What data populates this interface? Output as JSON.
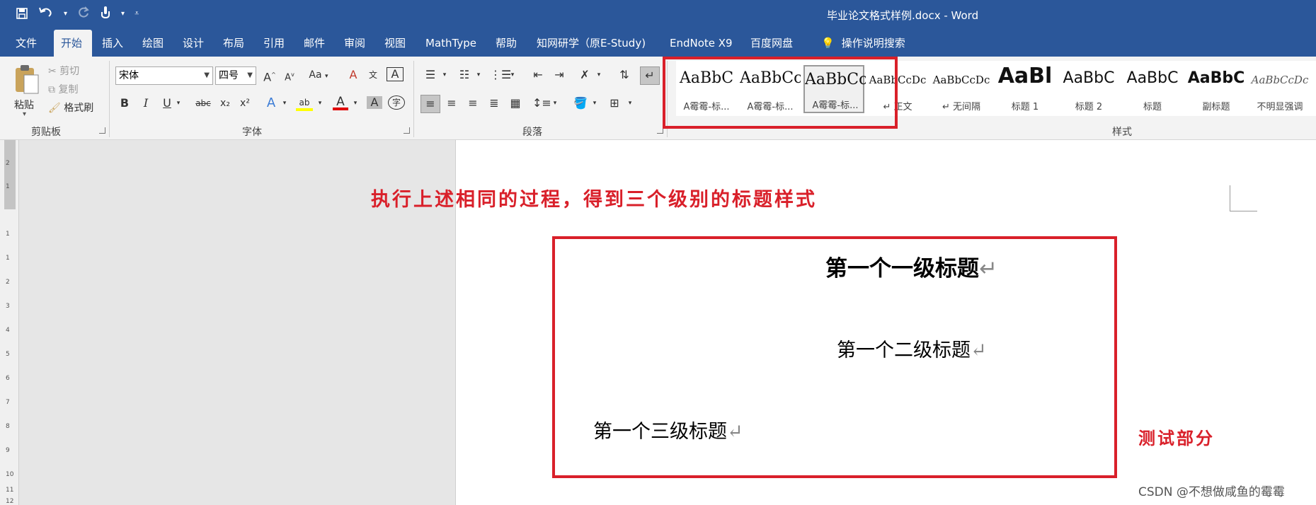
{
  "window": {
    "title": "毕业论文格式样例.docx  -  Word"
  },
  "qat": {
    "save_icon": "save-icon",
    "undo_icon": "undo-icon",
    "redo_icon": "redo-icon",
    "touch_icon": "touch-mode-icon",
    "customize_icon": "customize-icon"
  },
  "tabs": [
    "文件",
    "开始",
    "插入",
    "绘图",
    "设计",
    "布局",
    "引用",
    "邮件",
    "审阅",
    "视图",
    "MathType",
    "帮助",
    "知网研学（原E-Study)",
    "EndNote X9",
    "百度网盘"
  ],
  "tell_me": "操作说明搜索",
  "clipboard": {
    "paste": "粘贴",
    "cut": "剪切",
    "copy": "复制",
    "format_painter": "格式刷",
    "label": "剪贴板"
  },
  "font": {
    "name": "宋体",
    "size": "四号",
    "label": "字体",
    "bold": "B",
    "italic": "I",
    "underline": "U",
    "strike": "abc",
    "sub": "x₂",
    "sup": "x²",
    "grow": "A",
    "shrink": "A",
    "case": "Aa"
  },
  "paragraph": {
    "label": "段落"
  },
  "styles": {
    "label": "样式",
    "items": [
      {
        "sample": "AaBbC",
        "name": "A霉霉-标..."
      },
      {
        "sample": "AaBbCc",
        "name": "A霉霉-标..."
      },
      {
        "sample": "AaBbCc",
        "name": "A霉霉-标..."
      },
      {
        "sample": "AaBbCcDc",
        "name": "↵ 正文"
      },
      {
        "sample": "AaBbCcDc",
        "name": "↵ 无间隔"
      },
      {
        "sample": "AaBl",
        "name": "标题 1"
      },
      {
        "sample": "AaBbC",
        "name": "标题 2"
      },
      {
        "sample": "AaBbC",
        "name": "标题"
      },
      {
        "sample": "AaBbC",
        "name": "副标题"
      },
      {
        "sample": "AaBbCcDc",
        "name": "不明显强调"
      }
    ]
  },
  "document": {
    "annotation": "执行上述相同的过程，得到三个级别的标题样式",
    "heading1": "第一个一级标题",
    "heading2": "第一个二级标题",
    "heading3": "第一个三级标题",
    "paragraph_mark": "↵",
    "test_label": "测试部分"
  },
  "ruler_numbers": [
    "2",
    "1",
    "1",
    "1",
    "2",
    "3",
    "4",
    "5",
    "6",
    "7",
    "8",
    "9",
    "10",
    "11",
    "12"
  ],
  "watermark": "CSDN @不想做咸鱼的霉霉",
  "colors": {
    "accent": "#2b579a",
    "highlight_red": "#d9202a"
  }
}
